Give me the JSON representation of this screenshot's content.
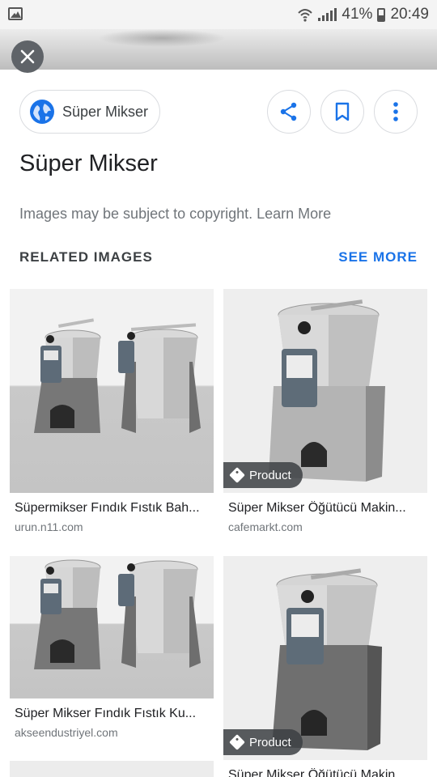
{
  "status_bar": {
    "battery": "41%",
    "time": "20:49"
  },
  "source_chip": {
    "label": "Süper Mikser"
  },
  "title": "Süper Mikser",
  "copyright_note": "Images may be subject to copyright. Learn More",
  "related": {
    "heading": "RELATED IMAGES",
    "see_more": "SEE MORE"
  },
  "results": [
    {
      "caption": "Süpermikser Fındık Fıstık Bah...",
      "domain": "urun.n11.com",
      "badge": ""
    },
    {
      "caption": "Süper Mikser Öğütücü Makin...",
      "domain": "cafemarkt.com",
      "badge": "Product"
    },
    {
      "caption": "Süper Mikser Fındık Fıstık Ku...",
      "domain": "akseendustriyel.com",
      "badge": ""
    },
    {
      "caption": "Süper Mikser Öğütücü Makin...",
      "domain": "",
      "badge": "Product"
    }
  ],
  "colors": {
    "accent": "#1a73e8",
    "text_primary": "#202124",
    "text_secondary": "#70757a"
  }
}
